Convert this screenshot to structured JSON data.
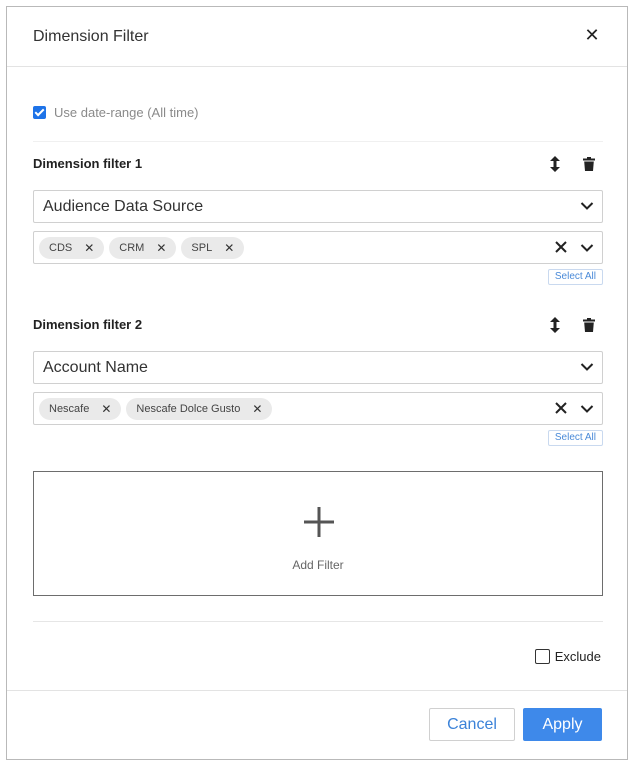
{
  "dialog": {
    "title": "Dimension Filter",
    "close_icon": "close-icon"
  },
  "date_range": {
    "checked": true,
    "label": "Use date-range (All time)"
  },
  "filters": [
    {
      "title": "Dimension filter 1",
      "dimension": "Audience Data Source",
      "values": [
        "CDS",
        "CRM",
        "SPL"
      ],
      "select_all_label": "Select All"
    },
    {
      "title": "Dimension filter 2",
      "dimension": "Account Name",
      "values": [
        "Nescafe",
        "Nescafe Dolce Gusto"
      ],
      "select_all_label": "Select All"
    }
  ],
  "add_filter": {
    "label": "Add Filter",
    "icon": "plus-icon"
  },
  "exclude": {
    "checked": false,
    "label": "Exclude"
  },
  "footer": {
    "cancel_label": "Cancel",
    "apply_label": "Apply"
  },
  "colors": {
    "accent": "#3e89ea",
    "checkbox": "#1e73e8",
    "chip_bg": "#eaeaea",
    "link": "#4a8ad8"
  }
}
